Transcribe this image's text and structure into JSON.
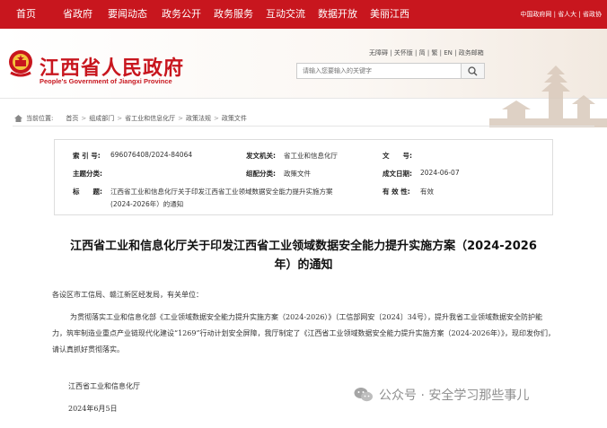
{
  "nav": {
    "items": [
      "首页",
      "省政府",
      "要闻动态",
      "政务公开",
      "政务服务",
      "互动交流",
      "数据开放",
      "美丽江西"
    ],
    "links": [
      "中国政府网",
      "省人大",
      "省政协"
    ]
  },
  "header": {
    "title": "江西省人民政府",
    "subtitle": "People's Government of Jiangxi Province",
    "tools": [
      "无障碍",
      "关怀版",
      "简",
      "繁",
      "EN",
      "政务邮箱"
    ],
    "search_placeholder": "请输入您要输入的关键字"
  },
  "breadcrumb": {
    "label": "当前位置:",
    "items": [
      "首页",
      "组成部门",
      "省工业和信息化厅",
      "政策法规",
      "政策文件"
    ]
  },
  "info": {
    "index_label": "索 引 号:",
    "index_value": "696076408/2024-84064",
    "agency_label": "发文机关:",
    "agency_value": "省工业和信息化厅",
    "docno_label": "文　　号:",
    "docno_value": "",
    "category_label": "主题分类:",
    "category_value": "",
    "genre_label": "组配分类:",
    "genre_value": "政策文件",
    "date_label": "成文日期:",
    "date_value": "2024-06-07",
    "title_label": "标　　题:",
    "title_value_1": "江西省工业和信息化厅关于印发江西省工业领域数据安全能力提升实施方案",
    "title_value_2": "(2024-2026年）的通知",
    "validity_label": "有 效 性:",
    "validity_value": "有效"
  },
  "article": {
    "title_line1": "江西省工业和信息化厅关于印发江西省工业领域数据安全能力提升实施方案（2024-2026",
    "title_line2": "年）的通知",
    "salutation": "各设区市工信局、赣江新区经发局，有关单位：",
    "paragraph": "为贯彻落实工业和信息化部《工业领域数据安全能力提升实施方案（2024-2026）》（工信部网安〔2024〕34号），提升我省工业领域数据安全防护能力，筑牢制造业重点产业链现代化建设“1269”行动计划安全屏障，我厅制定了《江西省工业领域数据安全能力提升实施方案（2024-2026年）》，现印发你们，请认真抓好贯彻落实。",
    "signature": "江西省工业和信息化厅",
    "date": "2024年6月5日"
  },
  "watermark": "公众号 · 安全学习那些事儿",
  "colors": {
    "brand_red": "#c8161e"
  }
}
